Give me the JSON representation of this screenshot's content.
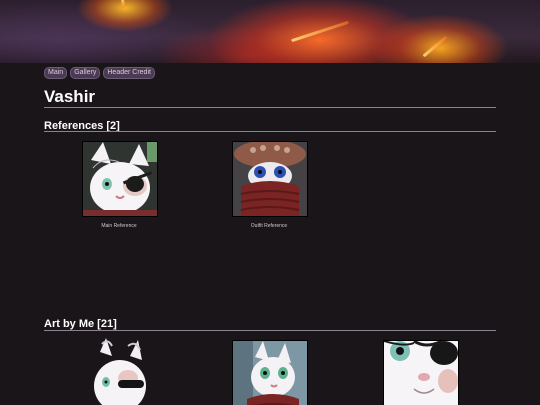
{
  "nav": {
    "items": [
      "Main",
      "Gallery",
      "Header Credit"
    ]
  },
  "profile": {
    "name": "Vashir"
  },
  "references": {
    "heading": "References [2]",
    "items": [
      {
        "caption": "Main Reference"
      },
      {
        "caption": "Outfit Reference"
      }
    ]
  },
  "art": {
    "heading": "Art by Me [21]"
  },
  "colors": {
    "background": "#1a1519",
    "nav_button": "#4a3a52",
    "rule": "#8a8290"
  }
}
